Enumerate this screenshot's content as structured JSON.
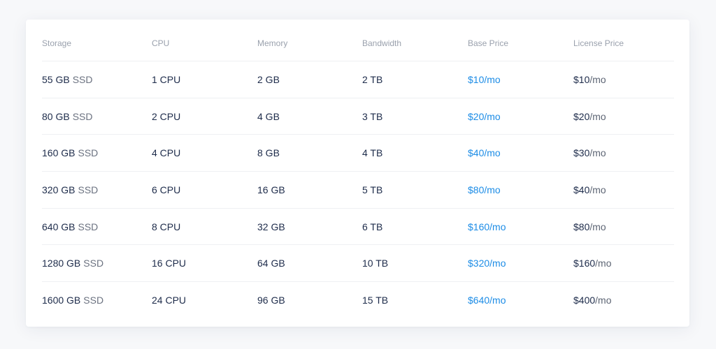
{
  "headers": [
    "Storage",
    "CPU",
    "Memory",
    "Bandwidth",
    "Base Price",
    "License Price"
  ],
  "rows": [
    {
      "storage": "55 GB",
      "storage_type": "SSD",
      "cpu": "1 CPU",
      "memory": "2 GB",
      "bandwidth": "2 TB",
      "base_price": "$10",
      "base_unit": "/mo",
      "license_price": "$10",
      "license_unit": "/mo"
    },
    {
      "storage": "80 GB",
      "storage_type": "SSD",
      "cpu": "2 CPU",
      "memory": "4 GB",
      "bandwidth": "3 TB",
      "base_price": "$20",
      "base_unit": "/mo",
      "license_price": "$20",
      "license_unit": "/mo"
    },
    {
      "storage": "160 GB",
      "storage_type": "SSD",
      "cpu": "4 CPU",
      "memory": "8 GB",
      "bandwidth": "4 TB",
      "base_price": "$40",
      "base_unit": "/mo",
      "license_price": "$30",
      "license_unit": "/mo"
    },
    {
      "storage": "320 GB",
      "storage_type": "SSD",
      "cpu": "6 CPU",
      "memory": "16 GB",
      "bandwidth": "5 TB",
      "base_price": "$80",
      "base_unit": "/mo",
      "license_price": "$40",
      "license_unit": "/mo"
    },
    {
      "storage": "640 GB",
      "storage_type": "SSD",
      "cpu": "8 CPU",
      "memory": "32 GB",
      "bandwidth": "6 TB",
      "base_price": "$160",
      "base_unit": "/mo",
      "license_price": "$80",
      "license_unit": "/mo"
    },
    {
      "storage": "1280 GB",
      "storage_type": "SSD",
      "cpu": "16 CPU",
      "memory": "64 GB",
      "bandwidth": "10 TB",
      "base_price": "$320",
      "base_unit": "/mo",
      "license_price": "$160",
      "license_unit": "/mo"
    },
    {
      "storage": "1600 GB",
      "storage_type": "SSD",
      "cpu": "24 CPU",
      "memory": "96 GB",
      "bandwidth": "15 TB",
      "base_price": "$640",
      "base_unit": "/mo",
      "license_price": "$400",
      "license_unit": "/mo"
    }
  ],
  "colors": {
    "accent": "#1c8ce6",
    "text": "#1d2b4a",
    "muted": "#6b7280",
    "header": "#9aa1ad",
    "divider": "#eef0f3"
  }
}
